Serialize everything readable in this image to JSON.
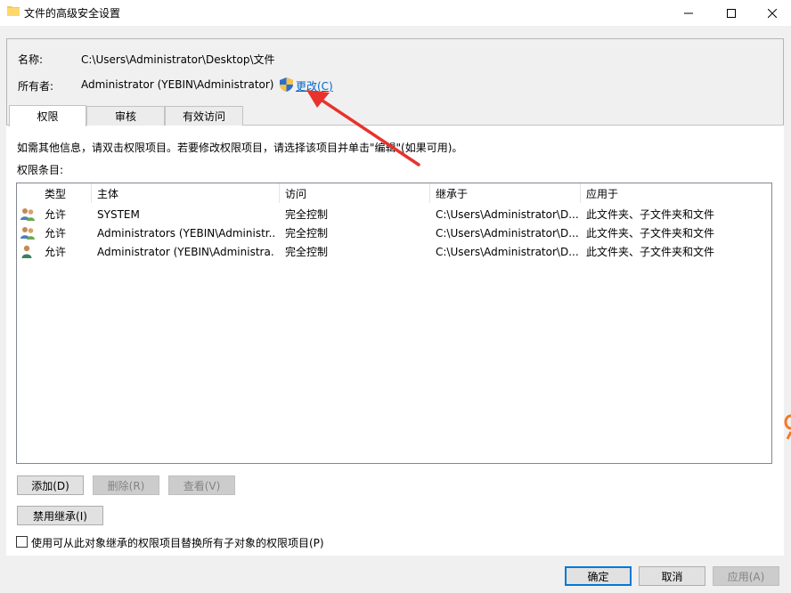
{
  "window": {
    "title": "文件的高级安全设置"
  },
  "info": {
    "name_label": "名称:",
    "name_value": "C:\\Users\\Administrator\\Desktop\\文件",
    "owner_label": "所有者:",
    "owner_value": "Administrator (YEBIN\\Administrator)",
    "change_link": "更改(C)"
  },
  "tabs": [
    {
      "label": "权限"
    },
    {
      "label": "审核"
    },
    {
      "label": "有效访问"
    }
  ],
  "panel": {
    "help_text": "如需其他信息，请双击权限项目。若要修改权限项目，请选择该项目并单击\"编辑\"(如果可用)。",
    "entries_label": "权限条目:"
  },
  "table": {
    "columns": [
      "类型",
      "主体",
      "访问",
      "继承于",
      "应用于"
    ],
    "rows": [
      {
        "type": "允许",
        "principal": "SYSTEM",
        "access": "完全控制",
        "inherited": "C:\\Users\\Administrator\\D...",
        "applies": "此文件夹、子文件夹和文件",
        "icon": "user-group-icon"
      },
      {
        "type": "允许",
        "principal": "Administrators (YEBIN\\Administr...",
        "access": "完全控制",
        "inherited": "C:\\Users\\Administrator\\D...",
        "applies": "此文件夹、子文件夹和文件",
        "icon": "user-group-icon"
      },
      {
        "type": "允许",
        "principal": "Administrator (YEBIN\\Administra...",
        "access": "完全控制",
        "inherited": "C:\\Users\\Administrator\\D...",
        "applies": "此文件夹、子文件夹和文件",
        "icon": "user-icon"
      }
    ]
  },
  "buttons": {
    "add": "添加(D)",
    "remove": "删除(R)",
    "view": "查看(V)",
    "disable_inheritance": "禁用继承(I)",
    "replace_checkbox": "使用可从此对象继承的权限项目替换所有子对象的权限项目(P)",
    "ok": "确定",
    "cancel": "取消",
    "apply": "应用(A)"
  },
  "colors": {
    "link": "#0066cc",
    "accent": "#0078d7",
    "arrow": "#e8322d"
  }
}
